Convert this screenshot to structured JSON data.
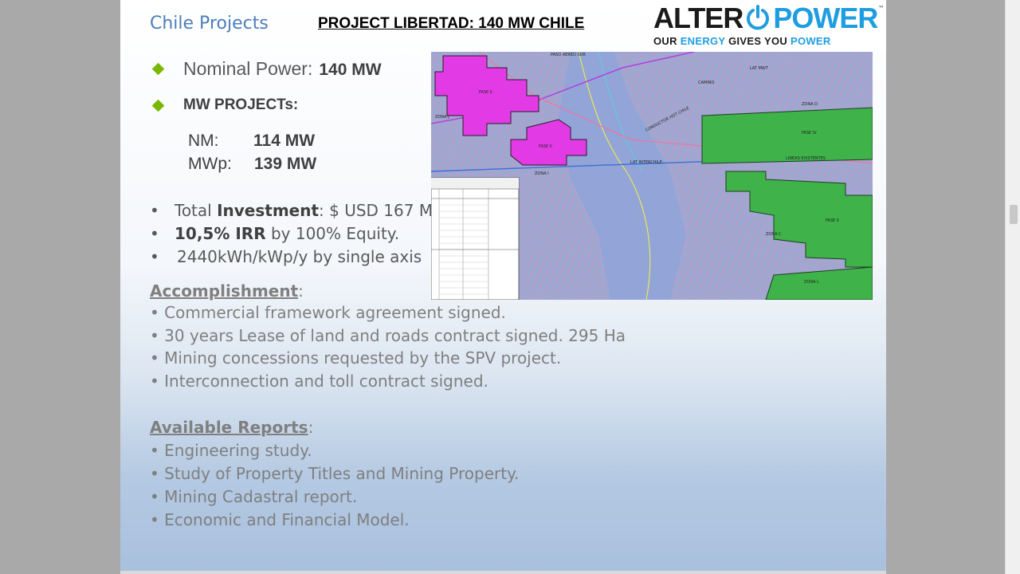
{
  "slide": {
    "section_label": "Chile Projects",
    "title": "PROJECT LIBERTAD: 140 MW CHILE"
  },
  "logo": {
    "alter": "ALTER",
    "power": "POWER",
    "tm": "™",
    "tagline_parts": [
      "OUR ",
      "ENERGY",
      " GIVES YOU ",
      "POWER"
    ]
  },
  "specs": {
    "nominal_label": "Nominal Power:",
    "nominal_value": "140 MW",
    "projects_label": "MW PROJECTs:",
    "nm_label": "NM:",
    "nm_value": "114  MW",
    "mwp_label": "MWp:",
    "mwp_value": "139  MW"
  },
  "bullets": {
    "investment_pre": "Total ",
    "investment_bold": "Investment",
    "investment_post": ": $ USD 167 M;",
    "irr_bold": "10,5% IRR",
    "irr_post": " by 100% Equity.",
    "yield": "2440kWh/kWp/y by single axis"
  },
  "accomplishment": {
    "heading": "Accomplishment",
    "colon": ":",
    "items": [
      "• Commercial framework agreement signed.",
      "• 30 years Lease of land and roads contract signed. 295 Ha",
      "• Mining concessions requested by the SPV project.",
      "• Interconnection and toll contract signed."
    ]
  },
  "reports": {
    "heading": "Available Reports",
    "colon": ":",
    "items": [
      "• Engineering study.",
      "• Study of Property Titles and Mining Property.",
      "• Mining Cadastral report.",
      "• Economic and Financial Model."
    ]
  },
  "map": {
    "labels": [
      "FASE II",
      "FASE II",
      "FASE IV",
      "FASE II",
      "ZONA I",
      "ZONA D",
      "ZONA L",
      "ZONA J",
      "LAT INTERCHILE",
      "LINEAS EXISTENTES",
      "CONDUCTOR HOT CHILE",
      "PASO AEREO SUR",
      "LAT MWT",
      "CAMINO",
      "ZONA C"
    ]
  },
  "colors": {
    "section_blue": "#4a7ebb",
    "diamond_green": "#7ab800",
    "logo_blue": "#1e9de0",
    "map_magenta": "#e23be6",
    "map_green": "#3fb34a"
  }
}
